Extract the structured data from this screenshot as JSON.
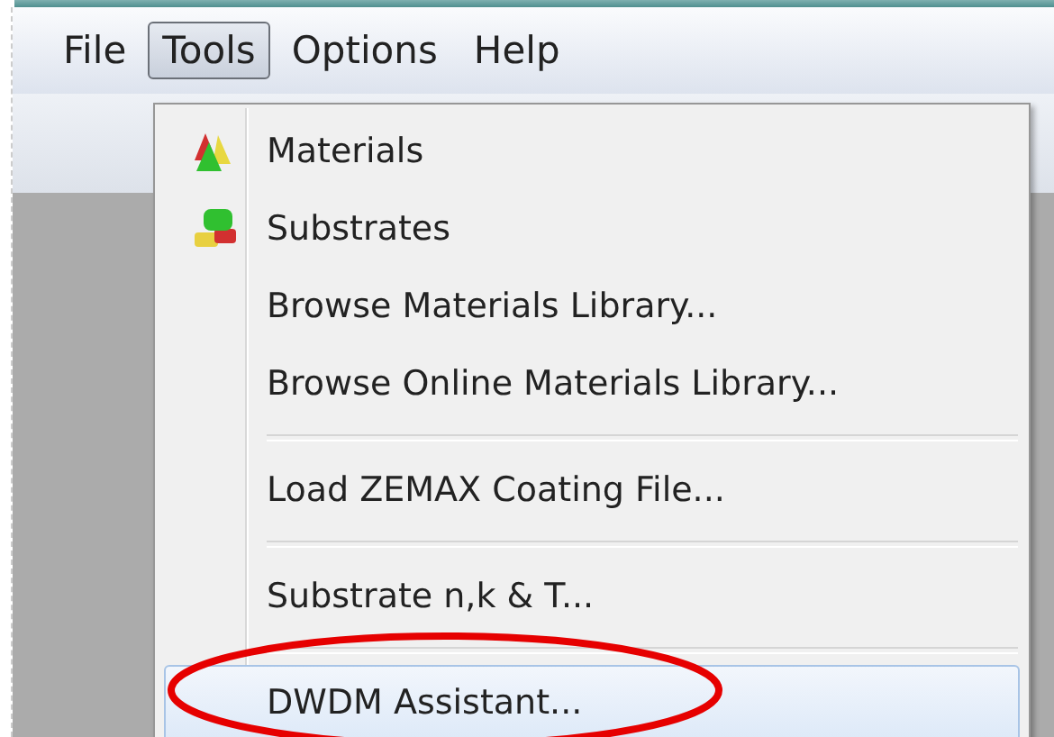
{
  "menubar": [
    {
      "label": "File",
      "selected": false
    },
    {
      "label": "Tools",
      "selected": true
    },
    {
      "label": "Options",
      "selected": false
    },
    {
      "label": "Help",
      "selected": false
    }
  ],
  "menu": [
    {
      "kind": "item",
      "label": "Materials",
      "selected": false,
      "circled": false
    },
    {
      "kind": "item",
      "label": "Substrates",
      "selected": false,
      "circled": false
    },
    {
      "kind": "item",
      "label": "Browse Materials Library...",
      "selected": false,
      "circled": false
    },
    {
      "kind": "item",
      "label": "Browse Online Materials Library...",
      "selected": false,
      "circled": false
    },
    {
      "kind": "separator"
    },
    {
      "kind": "item",
      "label": "Load ZEMAX Coating File...",
      "selected": false,
      "circled": false
    },
    {
      "kind": "separator"
    },
    {
      "kind": "item",
      "label": "Substrate n,k & T...",
      "selected": false,
      "circled": false
    },
    {
      "kind": "separator"
    },
    {
      "kind": "item",
      "label": "DWDM Assistant...",
      "selected": true,
      "circled": true
    }
  ]
}
